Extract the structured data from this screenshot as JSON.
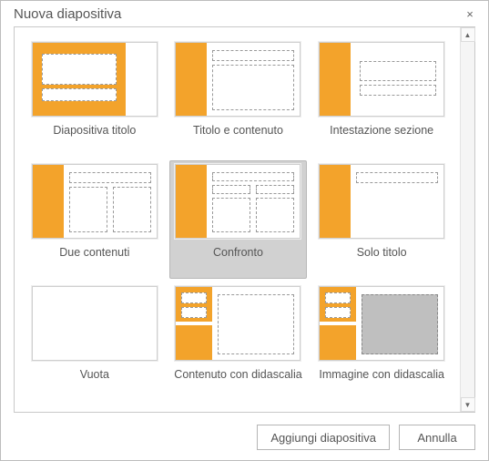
{
  "dialog": {
    "title": "Nuova diapositiva",
    "close_icon": "×"
  },
  "layouts": [
    {
      "id": "title-slide",
      "label": "Diapositiva titolo",
      "selected": false
    },
    {
      "id": "title-content",
      "label": "Titolo e contenuto",
      "selected": false
    },
    {
      "id": "section-header",
      "label": "Intestazione sezione",
      "selected": false
    },
    {
      "id": "two-content",
      "label": "Due contenuti",
      "selected": false
    },
    {
      "id": "comparison",
      "label": "Confronto",
      "selected": true
    },
    {
      "id": "title-only",
      "label": "Solo titolo",
      "selected": false
    },
    {
      "id": "blank",
      "label": "Vuota",
      "selected": false
    },
    {
      "id": "content-caption",
      "label": "Contenuto con didascalia",
      "selected": false
    },
    {
      "id": "picture-caption",
      "label": "Immagine con didascalia",
      "selected": false
    }
  ],
  "buttons": {
    "add": "Aggiungi diapositiva",
    "cancel": "Annulla"
  },
  "accent_color": "#f3a32b"
}
